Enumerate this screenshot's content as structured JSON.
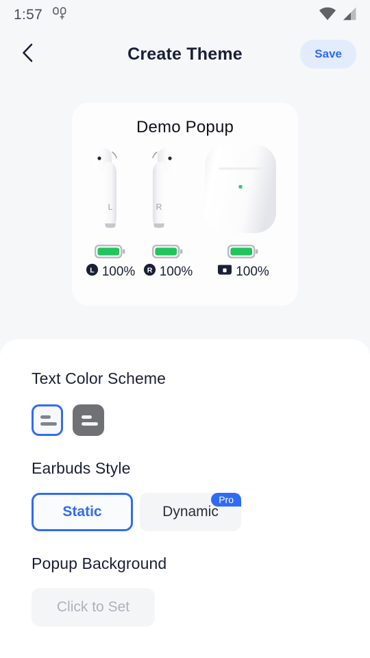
{
  "statusbar": {
    "time": "1:57",
    "icons": [
      "earbuds-icon",
      "wifi-icon",
      "cellular-signal-icon"
    ]
  },
  "header": {
    "back_icon": "chevron-left-icon",
    "title": "Create Theme",
    "save_label": "Save"
  },
  "demo": {
    "title": "Demo Popup",
    "devices": [
      "airpod-left",
      "airpod-right",
      "airpods-case"
    ],
    "earbud_left_label": "L",
    "earbud_right_label": "R",
    "batteries": [
      {
        "icon": "left-earbud-badge",
        "badge": "L",
        "value": "100%"
      },
      {
        "icon": "right-earbud-badge",
        "badge": "R",
        "value": "100%"
      },
      {
        "icon": "case-badge",
        "badge": "",
        "value": "100%"
      }
    ]
  },
  "sheet": {
    "text_color_scheme": {
      "title": "Text Color Scheme",
      "options": [
        {
          "name": "light",
          "selected": true
        },
        {
          "name": "dark",
          "selected": false
        }
      ]
    },
    "earbuds_style": {
      "title": "Earbuds Style",
      "options": [
        {
          "label": "Static",
          "selected": true,
          "badge": ""
        },
        {
          "label": "Dynamic",
          "selected": false,
          "badge": "Pro"
        }
      ]
    },
    "popup_background": {
      "title": "Popup Background",
      "button_label": "Click to Set"
    }
  },
  "colors": {
    "accent": "#2f6bf5",
    "accent_soft": "#e2ecfd",
    "page_bg": "#f6f7f9",
    "sheet_bg": "#ffffff",
    "battery_green": "#22c55e",
    "text_primary": "#1a1f36",
    "text_muted": "#aeb1b9"
  }
}
